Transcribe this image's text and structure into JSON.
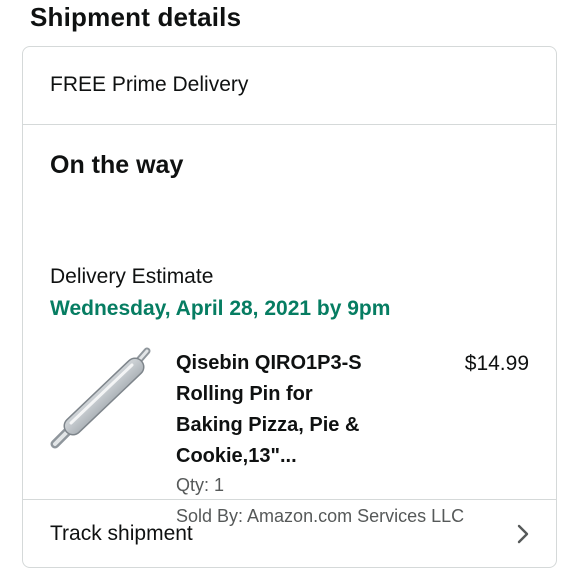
{
  "section": {
    "title": "Shipment details"
  },
  "card": {
    "delivery_type": "FREE Prime Delivery",
    "status": "On the way",
    "estimate_label": "Delivery Estimate",
    "estimate_date": "Wednesday, April 28, 2021 by 9pm",
    "item": {
      "image_icon": "rolling-pin-image",
      "title_lines": [
        "Qisebin QIRO1P3-S",
        "Rolling Pin for",
        "Baking Pizza, Pie &",
        "Cookie,13\"..."
      ],
      "price": "$14.99",
      "qty": "Qty: 1",
      "sold_by": "Sold By: Amazon.com Services LLC"
    },
    "track_label": "Track shipment",
    "track_icon": "chevron-right-icon"
  },
  "colors": {
    "estimate_green": "#067d62",
    "secondary_text": "#565959",
    "border": "#d5d9d9"
  }
}
